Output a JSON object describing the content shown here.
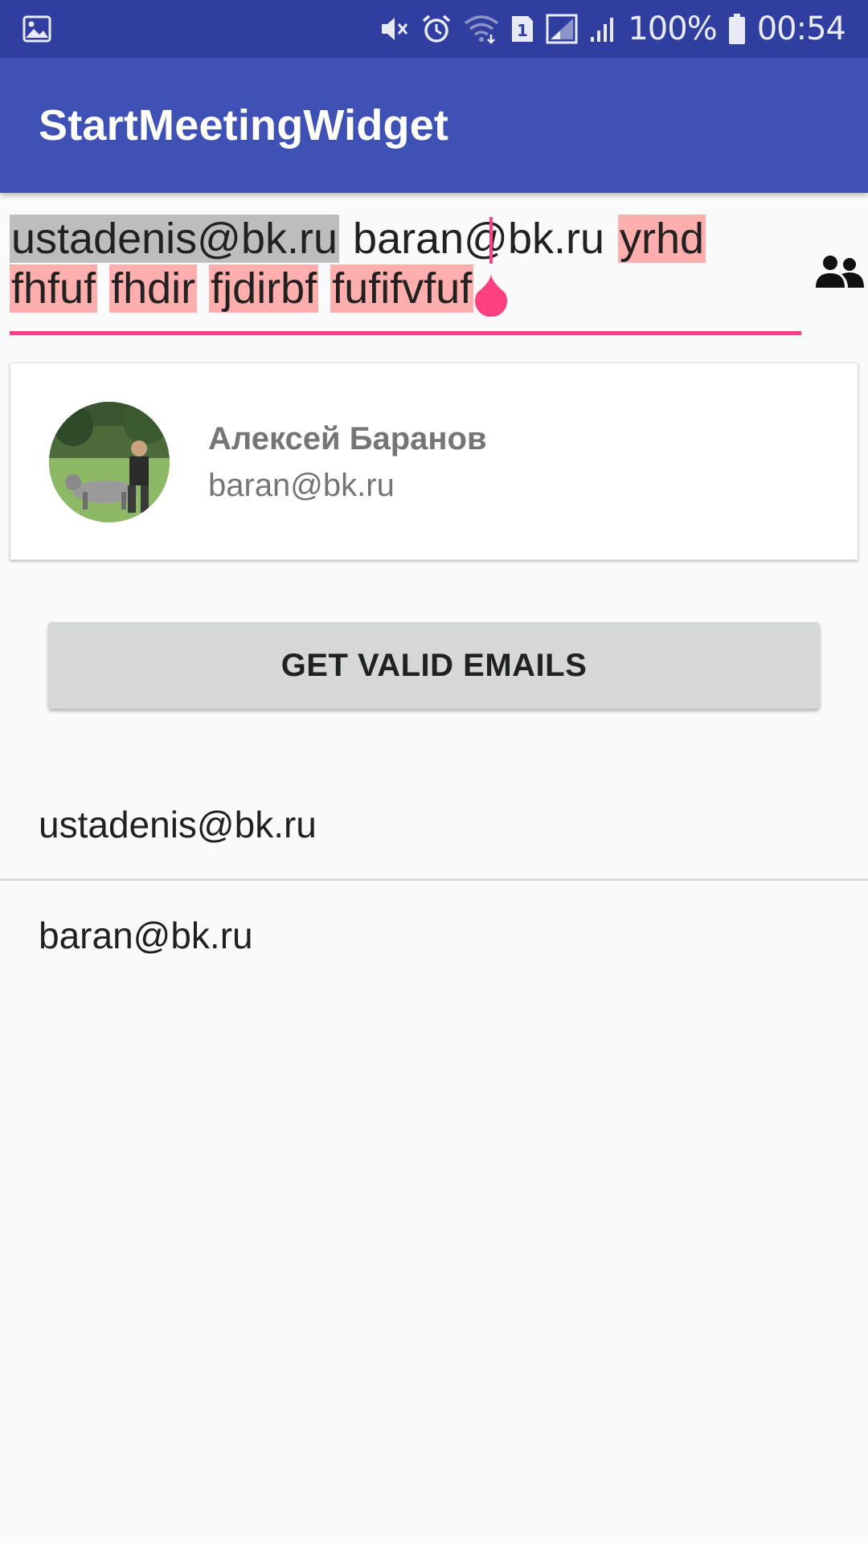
{
  "status_bar": {
    "battery": "100%",
    "time": "00:54",
    "sim_badge": "1",
    "icons": [
      "image-icon",
      "mute-icon",
      "alarm-icon",
      "wifi-icon",
      "sim1-icon",
      "signal-icon",
      "signal-bars-icon",
      "battery-icon"
    ]
  },
  "app_bar": {
    "title": "StartMeetingWidget"
  },
  "recipients_field": {
    "chips": [
      {
        "text": "ustadenis@bk.ru",
        "state": "valid"
      },
      {
        "text": "baran@bk.ru",
        "state": "plain"
      },
      {
        "text": "yrhd",
        "state": "invalid"
      },
      {
        "text": "fhfuf",
        "state": "invalid"
      },
      {
        "text": "fhdir",
        "state": "invalid"
      },
      {
        "text": "fjdirbf",
        "state": "invalid"
      },
      {
        "text": "fufifvfuf",
        "state": "invalid"
      }
    ],
    "colors": {
      "valid_chip": "#bdbdbd",
      "invalid_chip": "#ffaeae",
      "accent": "#ff4081"
    }
  },
  "contact_suggestion": {
    "name": "Алексей Баранов",
    "email": "baran@bk.ru"
  },
  "get_valid_button": {
    "label": "GET VALID EMAILS"
  },
  "valid_emails": [
    "ustadenis@bk.ru",
    "baran@bk.ru"
  ],
  "colors": {
    "primary": "#3f51b5",
    "primary_dark": "#303f9f",
    "accent": "#ff4081"
  }
}
